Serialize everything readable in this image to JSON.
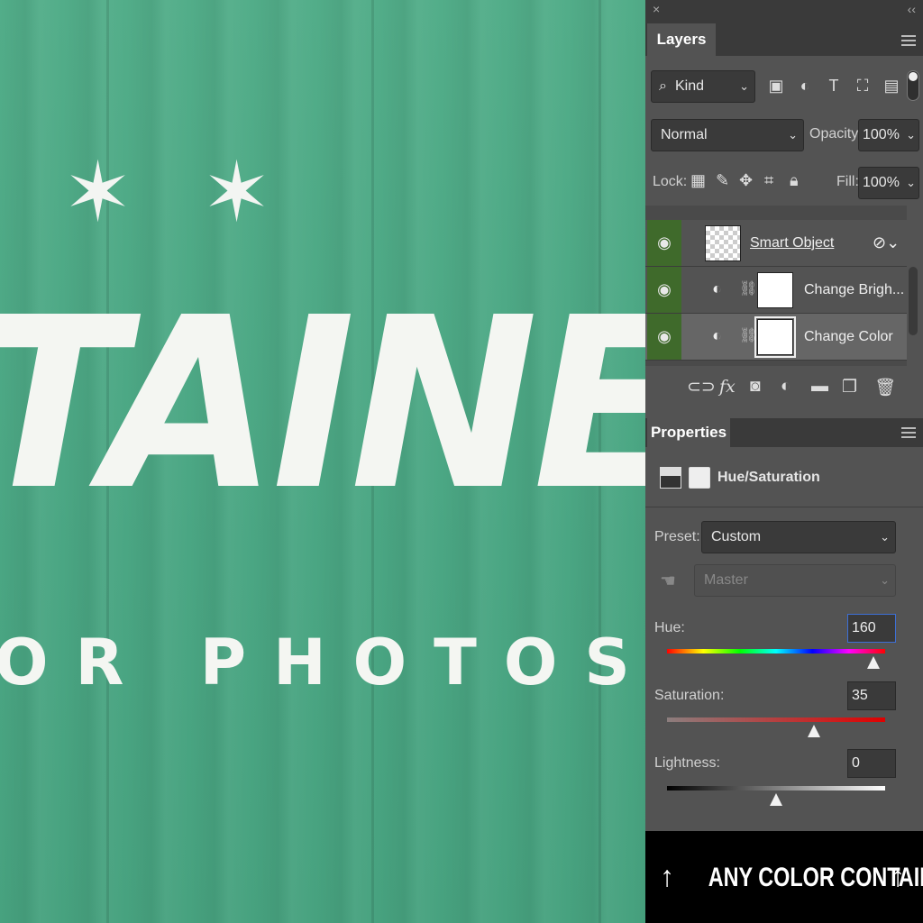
{
  "artwork": {
    "headline": "TAINER",
    "subline": "OR PHOTOSHOP",
    "background_color": "#4faa86",
    "ornament_icon": "six-point-star"
  },
  "layers_panel": {
    "close_glyph": "×",
    "collapse_glyph": "‹‹",
    "tab_label": "Layers",
    "filter": {
      "label": "Kind",
      "icons": [
        "image-filter-icon",
        "adjustment-filter-icon",
        "type-filter-icon",
        "shape-filter-icon",
        "smart-object-filter-icon"
      ]
    },
    "blend_mode": "Normal",
    "opacity_label": "Opacity:",
    "opacity_value": "100%",
    "lock_label": "Lock:",
    "fill_label": "Fill:",
    "fill_value": "100%",
    "layers": [
      {
        "name": "Smart Object",
        "type": "smart-object",
        "visible": true,
        "selected": false
      },
      {
        "name": "Change Brigh...",
        "type": "adjustment",
        "visible": true,
        "selected": false
      },
      {
        "name": "Change Color",
        "type": "adjustment",
        "visible": true,
        "selected": true
      }
    ],
    "footer_icons": [
      "link-icon",
      "fx-icon",
      "mask-icon",
      "adjustment-icon",
      "folder-icon",
      "new-layer-icon",
      "trash-icon"
    ]
  },
  "properties_panel": {
    "tab_label": "Properties",
    "adjustment_title": "Hue/Saturation",
    "preset_label": "Preset:",
    "preset_value": "Custom",
    "channel_value": "Master",
    "hue": {
      "label": "Hue:",
      "value": "160",
      "min": -180,
      "max": 180
    },
    "saturation": {
      "label": "Saturation:",
      "value": "35",
      "min": -100,
      "max": 100
    },
    "lightness": {
      "label": "Lightness:",
      "value": "0",
      "min": -100,
      "max": 100
    }
  },
  "banner": {
    "text": "ANY COLOR CONTAINER",
    "arrow_glyph": "↑"
  }
}
